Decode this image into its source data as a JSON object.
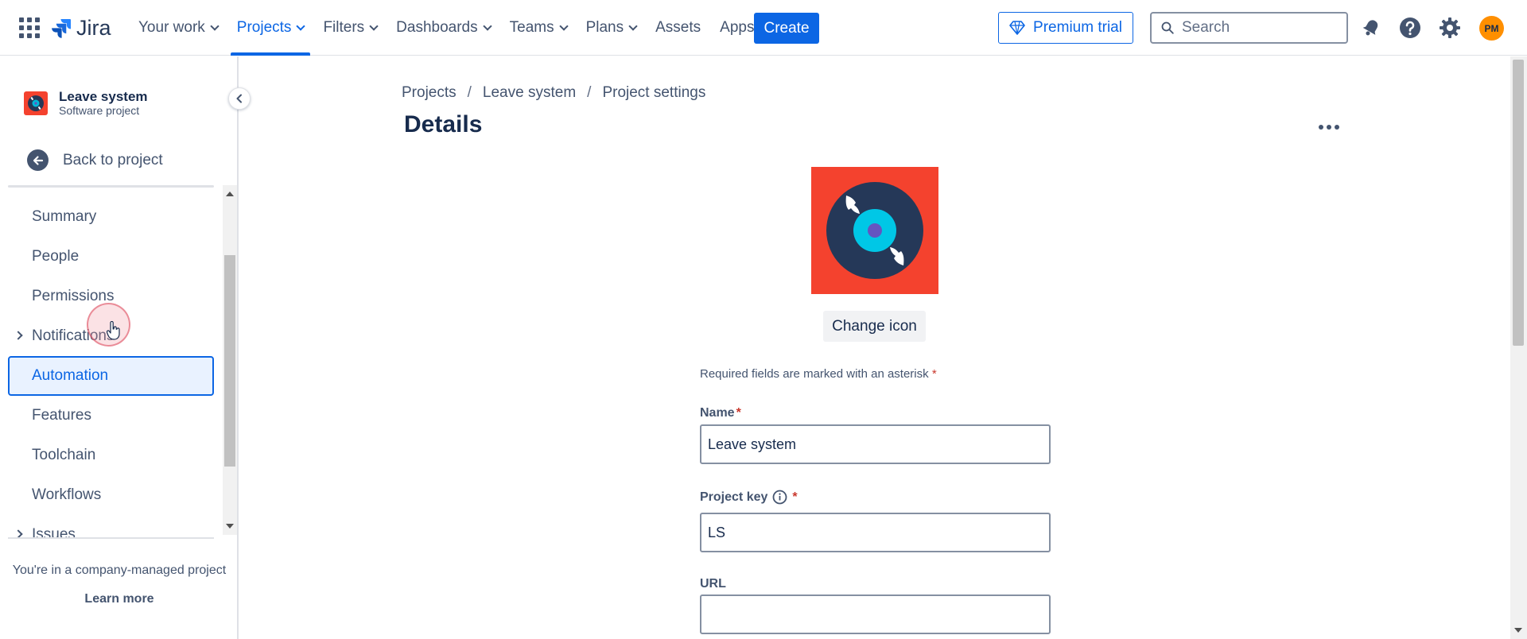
{
  "topnav": {
    "logo_text": "Jira",
    "items": [
      {
        "label": "Your work",
        "dropdown": true,
        "active": false
      },
      {
        "label": "Projects",
        "dropdown": true,
        "active": true
      },
      {
        "label": "Filters",
        "dropdown": true,
        "active": false
      },
      {
        "label": "Dashboards",
        "dropdown": true,
        "active": false
      },
      {
        "label": "Teams",
        "dropdown": true,
        "active": false
      },
      {
        "label": "Plans",
        "dropdown": true,
        "active": false
      },
      {
        "label": "Assets",
        "dropdown": false,
        "active": false
      },
      {
        "label": "Apps",
        "dropdown": true,
        "active": false
      }
    ],
    "create_label": "Create",
    "premium_label": "Premium trial",
    "search_placeholder": "Search",
    "avatar_initials": "PM"
  },
  "sidebar": {
    "project_name": "Leave system",
    "project_type": "Software project",
    "back_label": "Back to project",
    "items": [
      {
        "label": "Summary",
        "expandable": false
      },
      {
        "label": "People",
        "expandable": false
      },
      {
        "label": "Permissions",
        "expandable": false
      },
      {
        "label": "Notifications",
        "expandable": true
      },
      {
        "label": "Automation",
        "expandable": false,
        "active": true
      },
      {
        "label": "Features",
        "expandable": false
      },
      {
        "label": "Toolchain",
        "expandable": false
      },
      {
        "label": "Workflows",
        "expandable": false
      },
      {
        "label": "Issues",
        "expandable": true
      }
    ],
    "company_note": "You're in a company-managed project",
    "learn_more": "Learn more"
  },
  "main": {
    "breadcrumb": [
      "Projects",
      "Leave system",
      "Project settings"
    ],
    "title": "Details",
    "change_icon_label": "Change icon",
    "required_note": "Required fields are marked with an asterisk",
    "asterisk": "*",
    "fields": {
      "name_label": "Name",
      "name_value": "Leave system",
      "key_label": "Project key",
      "key_value": "LS",
      "url_label": "URL",
      "url_value": ""
    }
  },
  "colors": {
    "brand_blue": "#0c66e4",
    "project_icon_bg": "#f4422e",
    "text_primary": "#172b4d",
    "text_subtle": "#44546f",
    "required": "#c9372c"
  }
}
